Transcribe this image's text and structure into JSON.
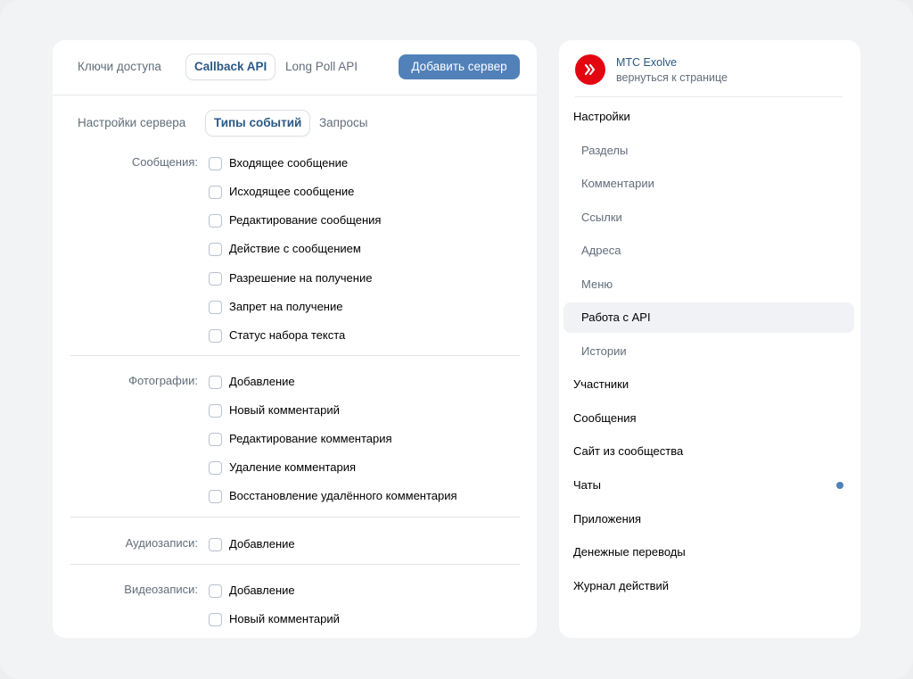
{
  "main": {
    "top_tabs": [
      {
        "label": "Ключи доступа",
        "active": false
      },
      {
        "label": "Callback API",
        "active": true
      },
      {
        "label": "Long Poll API",
        "active": false
      }
    ],
    "add_server_label": "Добавить сервер",
    "sub_tabs": [
      {
        "label": "Настройки сервера",
        "active": false
      },
      {
        "label": "Типы событий",
        "active": true
      },
      {
        "label": "Запросы",
        "active": false
      }
    ],
    "groups": [
      {
        "label": "Сообщения:",
        "items": [
          "Входящее сообщение",
          "Исходящее сообщение",
          "Редактирование сообщения",
          "Действие с сообщением",
          "Разрешение на получение",
          "Запрет на получение",
          "Статус набора текста"
        ]
      },
      {
        "label": "Фотографии:",
        "items": [
          "Добавление",
          "Новый комментарий",
          "Редактирование комментария",
          "Удаление комментария",
          "Восстановление удалённого комментария"
        ]
      },
      {
        "label": "Аудиозаписи:",
        "items": [
          "Добавление"
        ]
      },
      {
        "label": "Видеозаписи:",
        "items": [
          "Добавление",
          "Новый комментарий"
        ]
      }
    ]
  },
  "sidebar": {
    "community_name": "МТС Exolve",
    "back_link": "вернуться к странице",
    "logo_icon": "mts-exolve-logo-icon",
    "brand_color": "#e30611",
    "accent_color": "#5181b8",
    "menu": [
      {
        "label": "Настройки",
        "level": "top"
      },
      {
        "label": "Разделы",
        "level": "sub"
      },
      {
        "label": "Комментарии",
        "level": "sub"
      },
      {
        "label": "Ссылки",
        "level": "sub"
      },
      {
        "label": "Адреса",
        "level": "sub"
      },
      {
        "label": "Меню",
        "level": "sub"
      },
      {
        "label": "Работа с API",
        "level": "sub",
        "selected": true
      },
      {
        "label": "Истории",
        "level": "sub"
      },
      {
        "label": "Участники",
        "level": "top"
      },
      {
        "label": "Сообщения",
        "level": "top"
      },
      {
        "label": "Сайт из сообщества",
        "level": "top"
      },
      {
        "label": "Чаты",
        "level": "top",
        "dot": true
      },
      {
        "label": "Приложения",
        "level": "top"
      },
      {
        "label": "Денежные переводы",
        "level": "top"
      },
      {
        "label": "Журнал действий",
        "level": "top"
      }
    ]
  }
}
